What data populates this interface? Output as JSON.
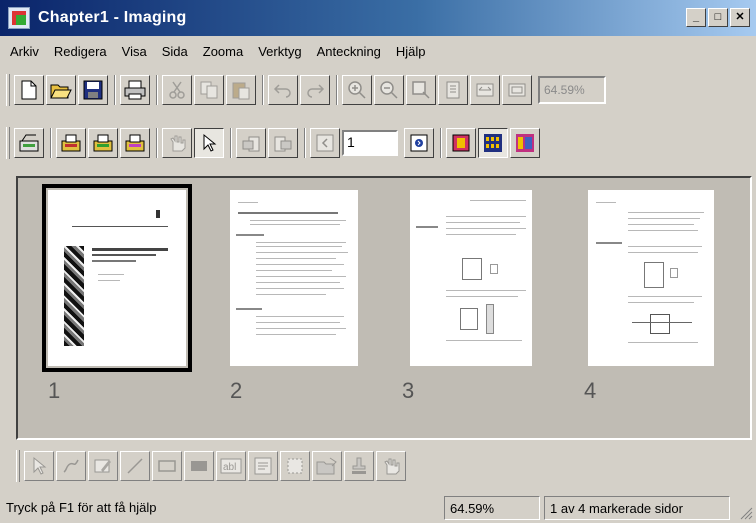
{
  "window": {
    "title": "Chapter1 - Imaging",
    "controls": {
      "minimize": "_",
      "maximize": "□",
      "close": "✕"
    }
  },
  "menu": [
    {
      "label": "Arkiv"
    },
    {
      "label": "Redigera"
    },
    {
      "label": "Visa"
    },
    {
      "label": "Sida"
    },
    {
      "label": "Zooma"
    },
    {
      "label": "Verktyg"
    },
    {
      "label": "Anteckning"
    },
    {
      "label": "Hjälp"
    }
  ],
  "toolbar_standard": {
    "buttons": [
      "new-icon",
      "open-icon",
      "save-icon",
      "print-icon",
      "cut-icon",
      "copy-icon",
      "paste-icon",
      "undo-icon",
      "redo-icon",
      "zoom-in-icon",
      "zoom-out-icon",
      "zoom-select-icon",
      "best-fit-icon",
      "fit-width-icon",
      "actual-size-icon"
    ],
    "zoom_value": "64.59%"
  },
  "toolbar_pages": {
    "buttons": [
      "scan-icon",
      "scan-new-icon",
      "insert-scan-icon",
      "append-scan-icon",
      "drag-icon",
      "select-icon",
      "rotate-left-icon",
      "rotate-right-icon",
      "prev-page-icon",
      "next-page-icon",
      "one-page-icon",
      "thumbnails-icon",
      "page-thumbnails-icon"
    ],
    "page_number": "1"
  },
  "thumbnails": [
    {
      "number": "1",
      "selected": true
    },
    {
      "number": "2",
      "selected": false
    },
    {
      "number": "3",
      "selected": false
    },
    {
      "number": "4",
      "selected": false
    }
  ],
  "annotation_toolbar": {
    "buttons": [
      "pointer-icon",
      "freehand-icon",
      "highlighter-icon",
      "line-icon",
      "hollow-rect-icon",
      "filled-rect-icon",
      "text-icon",
      "attach-note-icon",
      "text-from-file-icon",
      "rubber-stamp-icon",
      "stamp-icon",
      "hand-icon"
    ],
    "text_label": "abl"
  },
  "status": {
    "help": "Tryck på F1 för att få hjälp",
    "zoom": "64.59%",
    "pages": "1 av 4 markerade sidor"
  }
}
